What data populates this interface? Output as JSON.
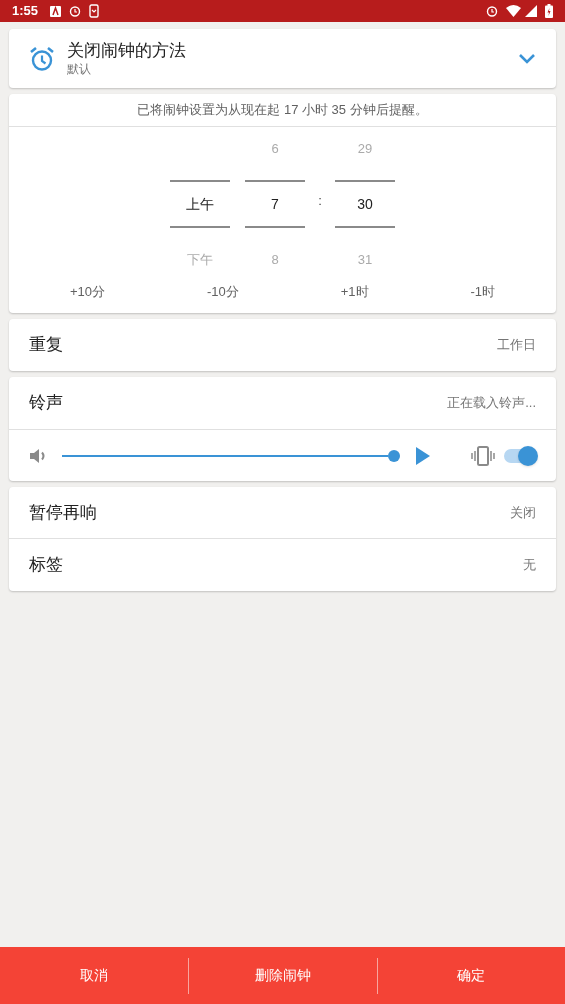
{
  "status_bar": {
    "time": "1:55"
  },
  "alarm_method": {
    "title": "关闭闹钟的方法",
    "subtitle": "默认",
    "expanded": false
  },
  "summary": "已将闹钟设置为从现在起 17 小时 35 分钟后提醒。",
  "picker": [
    {
      "kind": "column",
      "value": "上午",
      "below": "下午"
    },
    {
      "kind": "column",
      "above": "6",
      "value": "7",
      "below": "8"
    },
    {
      "kind": "separator",
      "value": ":"
    },
    {
      "kind": "column",
      "above": "29",
      "value": "30",
      "below": "31"
    }
  ],
  "quick_adjust": [
    "+10分",
    "-10分",
    "+1时",
    "-1时"
  ],
  "repeat": {
    "label": "重复",
    "value": "工作日"
  },
  "ringtone": {
    "label": "铃声",
    "value": "正在载入铃声...",
    "volume": {
      "level": 1
    },
    "vibrate": {
      "on": true
    }
  },
  "settings": [
    {
      "label": "暂停再响",
      "value": "关闭"
    },
    {
      "label": "标签",
      "value": "无"
    }
  ],
  "buttons": [
    "取消",
    "删除闹钟",
    "确定"
  ]
}
